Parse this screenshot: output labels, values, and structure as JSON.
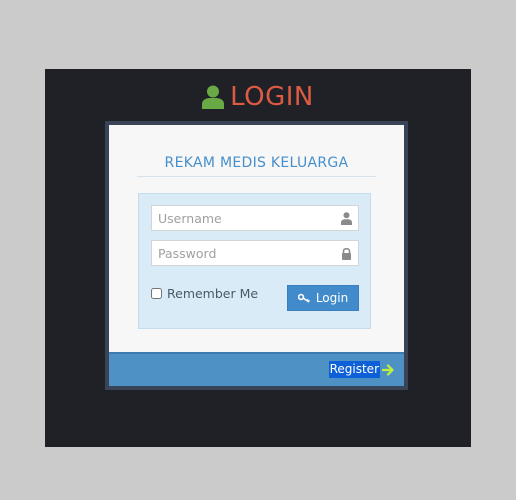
{
  "header": {
    "title": "LOGIN",
    "icon": "user-icon",
    "icon_color": "#69aa46",
    "title_color": "#dd5a43"
  },
  "app": {
    "title": "REKAM MEDIS KELUARGA",
    "title_color": "#478fca"
  },
  "form": {
    "username": {
      "value": "",
      "placeholder": "Username",
      "icon": "user-icon"
    },
    "password": {
      "value": "",
      "placeholder": "Password",
      "icon": "lock-icon"
    },
    "remember_label": "Remember Me",
    "remember_checked": false,
    "login_label": "Login",
    "login_icon": "key-icon"
  },
  "toolbar": {
    "register_label": "Register",
    "register_icon": "arrow-right-icon",
    "arrow_color": "#c0f03c"
  }
}
